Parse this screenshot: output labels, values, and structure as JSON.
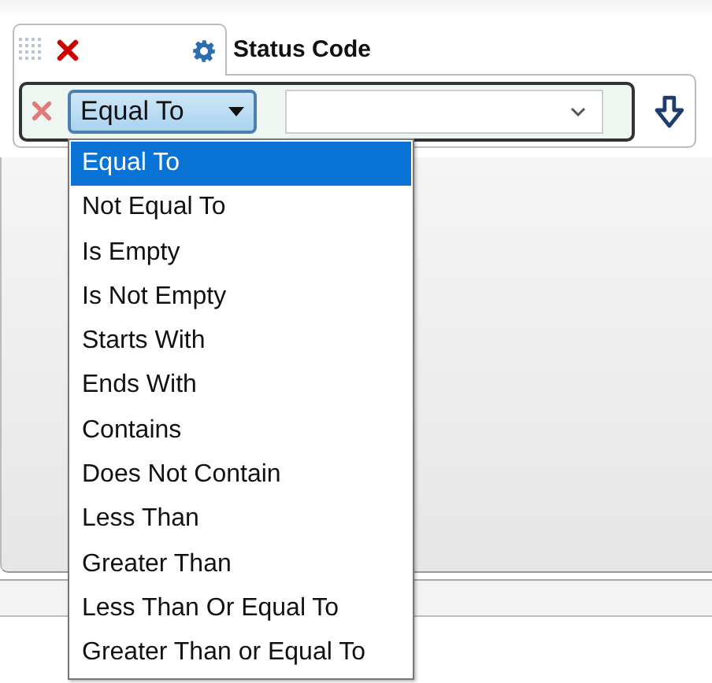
{
  "filter": {
    "field_label": "Status Code",
    "operator": "Equal To",
    "dropdown_open": true
  },
  "options": [
    {
      "label": "Equal To",
      "selected": true
    },
    {
      "label": "Not Equal To",
      "selected": false
    },
    {
      "label": "Is Empty",
      "selected": false
    },
    {
      "label": "Is Not Empty",
      "selected": false
    },
    {
      "label": "Starts With",
      "selected": false
    },
    {
      "label": "Ends With",
      "selected": false
    },
    {
      "label": "Contains",
      "selected": false
    },
    {
      "label": "Does Not Contain",
      "selected": false
    },
    {
      "label": "Less Than",
      "selected": false
    },
    {
      "label": "Greater Than",
      "selected": false
    },
    {
      "label": "Less Than Or Equal To",
      "selected": false
    },
    {
      "label": "Greater Than or Equal To",
      "selected": false
    }
  ]
}
